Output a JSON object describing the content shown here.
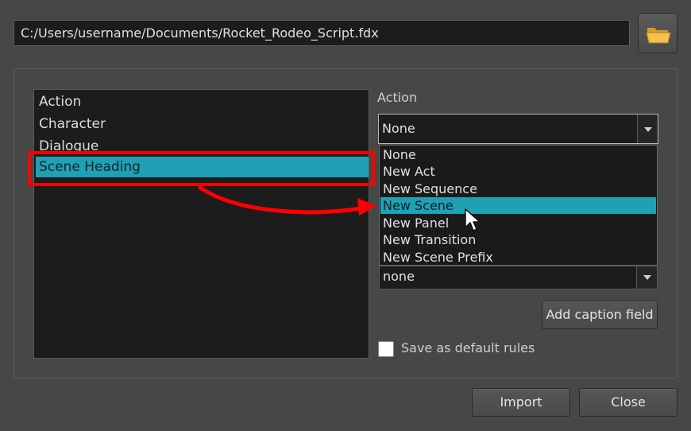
{
  "file": {
    "path": "C:/Users/username/Documents/Rocket_Rodeo_Script.fdx",
    "browse_icon": "folder-open-icon"
  },
  "element_types": {
    "items": [
      "Action",
      "Character",
      "Dialogue",
      "Scene Heading"
    ],
    "selected": "Scene Heading"
  },
  "action": {
    "label": "Action",
    "selected_value": "None",
    "options": [
      "None",
      "New Act",
      "New Sequence",
      "New Scene",
      "New Panel",
      "New Transition",
      "New Scene Prefix"
    ],
    "hovered": "New Scene"
  },
  "second_combo": {
    "value": "none"
  },
  "buttons": {
    "add_caption": "Add caption field",
    "import": "Import",
    "close": "Close"
  },
  "save_default": {
    "label": "Save as default rules",
    "checked": false
  },
  "annotation": {
    "highlight_color": "#ff0000",
    "accent": "#1fa0b4"
  }
}
